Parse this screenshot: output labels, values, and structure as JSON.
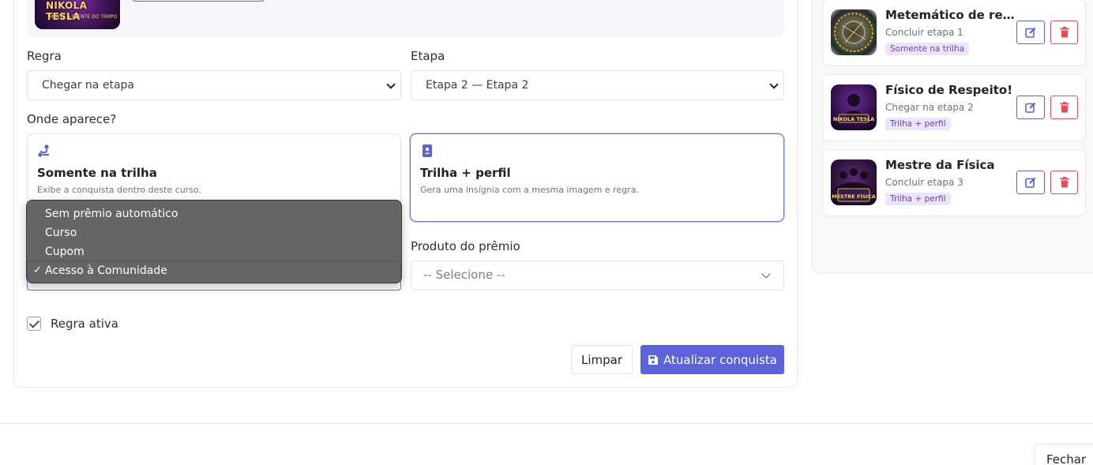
{
  "form": {
    "preview_image_text": "NIKOLA TESLA",
    "preview_image_subtext": "MENTE À FRENTE DO TEMPO",
    "rule_label": "Regra",
    "rule_value": "Chegar na etapa",
    "stage_label": "Etapa",
    "stage_value": "Etapa 2 — Etapa 2",
    "where_label": "Onde aparece?",
    "options": [
      {
        "title": "Somente na trilha",
        "desc": "Exibe a conquista dentro deste curso.",
        "icon": "route-icon",
        "selected": false
      },
      {
        "title": "Trilha + perfil",
        "desc": "Gera uma insígnia com a mesma imagem e regra.",
        "icon": "id-badge-icon",
        "selected": true
      }
    ],
    "reward_type_menu": [
      {
        "label": "Sem prêmio automático",
        "checked": false
      },
      {
        "label": "Curso",
        "checked": false
      },
      {
        "label": "Cupom",
        "checked": false
      },
      {
        "label": "Acesso à Comunidade",
        "checked": true
      }
    ],
    "reward_product_label": "Produto do prêmio",
    "reward_product_placeholder": "-- Selecione --",
    "active_label": "Regra ativa",
    "active_checked": true,
    "clear_button": "Limpar",
    "submit_button": "Atualizar conquista"
  },
  "achievements": [
    {
      "name": "Metemático de respeito!",
      "rule": "Concluir etapa 1",
      "badge": "Somente na trilha",
      "image_text": ""
    },
    {
      "name": "Físico de Respeito!",
      "rule": "Chegar na etapa 2",
      "badge": "Trilha + perfil",
      "image_text": "NIKOLA TESLA"
    },
    {
      "name": "Mestre da Física",
      "rule": "Concluir etapa 3",
      "badge": "Trilha + perfil",
      "image_text": "MESTRE FÍSICA"
    }
  ],
  "footer": {
    "close_button": "Fechar"
  },
  "colors": {
    "primary": "#5a62dc",
    "danger": "#e34d5a",
    "badge_bg": "#ede4fb",
    "badge_text": "#6a3fb5"
  }
}
